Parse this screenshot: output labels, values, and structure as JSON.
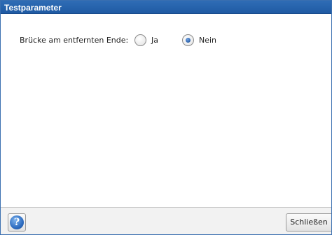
{
  "dialog": {
    "title": "Testparameter"
  },
  "parameter": {
    "label": "Brücke am entfernten Ende:",
    "options": [
      {
        "label": "Ja",
        "selected": false
      },
      {
        "label": "Nein",
        "selected": true
      }
    ]
  },
  "footer": {
    "help_icon": "help-icon",
    "help_glyph": "?",
    "close_label": "Schließen"
  },
  "colors": {
    "titlebar": "#2f6db6",
    "radio_selected": "#2a5fa8"
  }
}
